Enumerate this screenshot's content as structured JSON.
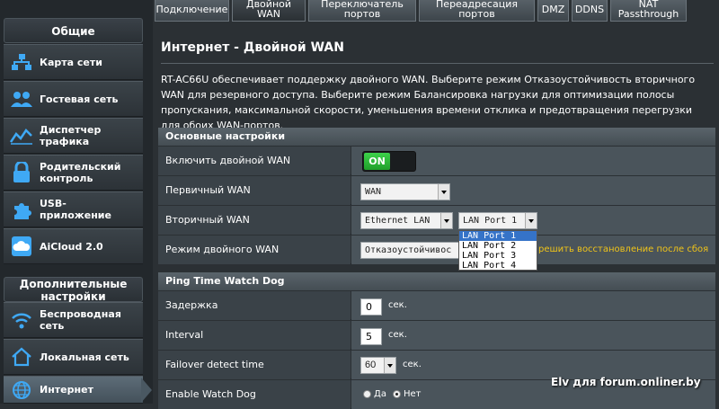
{
  "sidebar": {
    "general_header": "Общие",
    "advanced_header_line1": "Дополнительные",
    "advanced_header_line2": "настройки",
    "items": [
      {
        "line1": "Карта сети",
        "line2": "",
        "icon": "network-map-icon"
      },
      {
        "line1": "Гостевая сеть",
        "line2": "",
        "icon": "guest-network-icon"
      },
      {
        "line1": "Диспетчер",
        "line2": "трафика",
        "icon": "traffic-manager-icon"
      },
      {
        "line1": "Родительский",
        "line2": "контроль",
        "icon": "parental-control-icon"
      },
      {
        "line1": "USB-",
        "line2": "приложение",
        "icon": "usb-app-icon"
      },
      {
        "line1": "AiCloud 2.0",
        "line2": "",
        "icon": "cloud-icon"
      }
    ],
    "advanced_items": [
      {
        "line1": "Беспроводная",
        "line2": "сеть",
        "icon": "wireless-icon"
      },
      {
        "line1": "Локальная сеть",
        "line2": "",
        "icon": "lan-home-icon"
      },
      {
        "line1": "Интернет",
        "line2": "",
        "icon": "globe-icon",
        "active": true
      }
    ]
  },
  "tabs": [
    {
      "line1": "Подключение",
      "line2": ""
    },
    {
      "line1": "Двойной",
      "line2": "WAN",
      "active": true
    },
    {
      "line1": "Переключатель",
      "line2": "портов"
    },
    {
      "line1": "Переадресация",
      "line2": "портов"
    },
    {
      "line1": "DMZ",
      "line2": ""
    },
    {
      "line1": "DDNS",
      "line2": ""
    },
    {
      "line1": "NAT",
      "line2": "Passthrough"
    }
  ],
  "main": {
    "title": "Интернет - Двойной WAN",
    "description": "RT-AC66U обеспечивает поддержку двойного WAN. Выберите режим Отказоустойчивость вторичного WAN для резервного доступа. Выберите режим Балансировка нагрузки для оптимизации полосы пропускания, максимальной скорости, уменьшения времени отклика и предотвращения перегрузки для обоих WAN-портов.",
    "basic_section": "Основные настройки",
    "enable_dual_wan_label": "Включить двойной WAN",
    "toggle_state": "ON",
    "primary_wan_label": "Первичный WAN",
    "primary_wan_value": "WAN",
    "secondary_wan_label": "Вторичный WAN",
    "secondary_wan_value": "Ethernet LAN",
    "lan_port_value": "LAN Port 1",
    "lan_port_options": [
      "LAN Port 1",
      "LAN Port 2",
      "LAN Port 3",
      "LAN Port 4"
    ],
    "dual_wan_mode_label": "Режим двойного WAN",
    "dual_wan_mode_value": "Отказоустойчивос",
    "failback_hint": "решить восстановление после сбоя",
    "ping_section": "Ping Time Watch Dog",
    "delay_label": "Задержка",
    "delay_value": "0",
    "interval_label": "Interval",
    "interval_value": "5",
    "failover_label": "Failover detect time",
    "failover_value": "60",
    "unit_sec": "сек.",
    "watchdog_label": "Enable Watch Dog",
    "watchdog_yes": "Да",
    "watchdog_no": "Нет",
    "watchdog_selected": "Нет"
  },
  "watermark": "Elv для forum.onliner.by",
  "colors": {
    "background": "#2b3034",
    "toggle_on": "#2fbf3b",
    "hint": "#f0c419",
    "dropdown_selected": "#3573c8"
  }
}
